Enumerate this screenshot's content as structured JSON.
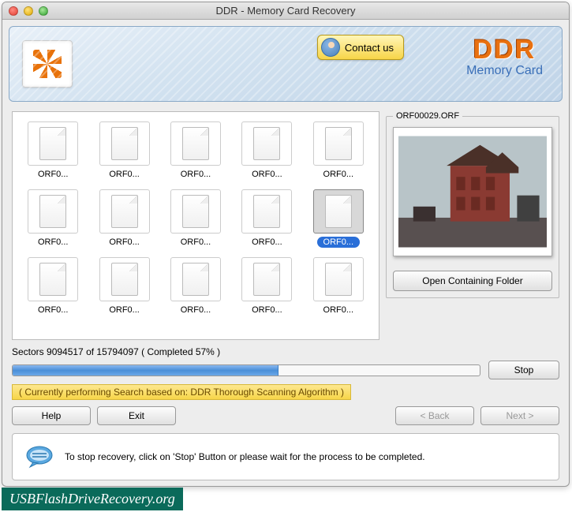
{
  "window": {
    "title": "DDR - Memory Card Recovery"
  },
  "header": {
    "contact_label": "Contact us",
    "brand_main": "DDR",
    "brand_sub": "Memory Card"
  },
  "files": {
    "items": [
      {
        "label": "ORF0...",
        "selected": false
      },
      {
        "label": "ORF0...",
        "selected": false
      },
      {
        "label": "ORF0...",
        "selected": false
      },
      {
        "label": "ORF0...",
        "selected": false
      },
      {
        "label": "ORF0...",
        "selected": false
      },
      {
        "label": "ORF0...",
        "selected": false
      },
      {
        "label": "ORF0...",
        "selected": false
      },
      {
        "label": "ORF0...",
        "selected": false
      },
      {
        "label": "ORF0...",
        "selected": false
      },
      {
        "label": "ORF0...",
        "selected": true
      },
      {
        "label": "ORF0...",
        "selected": false
      },
      {
        "label": "ORF0...",
        "selected": false
      },
      {
        "label": "ORF0...",
        "selected": false
      },
      {
        "label": "ORF0...",
        "selected": false
      },
      {
        "label": "ORF0...",
        "selected": false
      }
    ]
  },
  "preview": {
    "filename": "ORF00029.ORF",
    "open_folder_label": "Open Containing Folder"
  },
  "progress": {
    "sectors_current": 9094517,
    "sectors_total": 15794097,
    "percent": 57,
    "text": "Sectors 9094517 of 15794097   ( Completed 57% )",
    "stop_label": "Stop",
    "status": "( Currently performing Search based on: DDR Thorough Scanning Algorithm )"
  },
  "nav": {
    "help_label": "Help",
    "exit_label": "Exit",
    "back_label": "< Back",
    "next_label": "Next >"
  },
  "info": {
    "text": "To stop recovery, click on 'Stop' Button or please wait for the process to be completed."
  },
  "watermark": "USBFlashDriveRecovery.org"
}
